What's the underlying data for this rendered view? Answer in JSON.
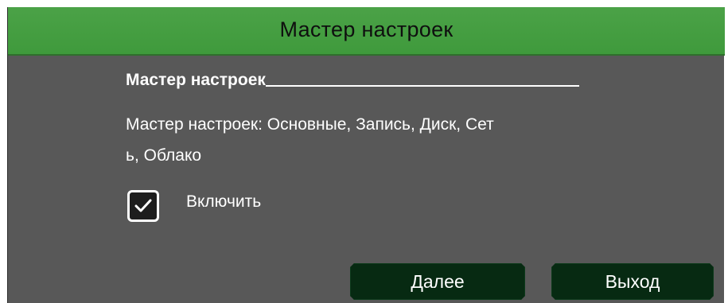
{
  "dialog": {
    "title": "Мастер настроек",
    "heading": "Мастер настроек",
    "description_line1": "Мастер настроек: Основные, Запись, Диск, Сет",
    "description_line2": "ь, Облако",
    "enable_checkbox": {
      "label": "Включить",
      "checked": true
    },
    "buttons": {
      "next_label": "Далее",
      "exit_label": "Выход"
    }
  },
  "colors": {
    "titlebar": "#46a042",
    "dialog_bg": "#585858",
    "button_bg": "#072a12",
    "text": "#ffffff"
  }
}
